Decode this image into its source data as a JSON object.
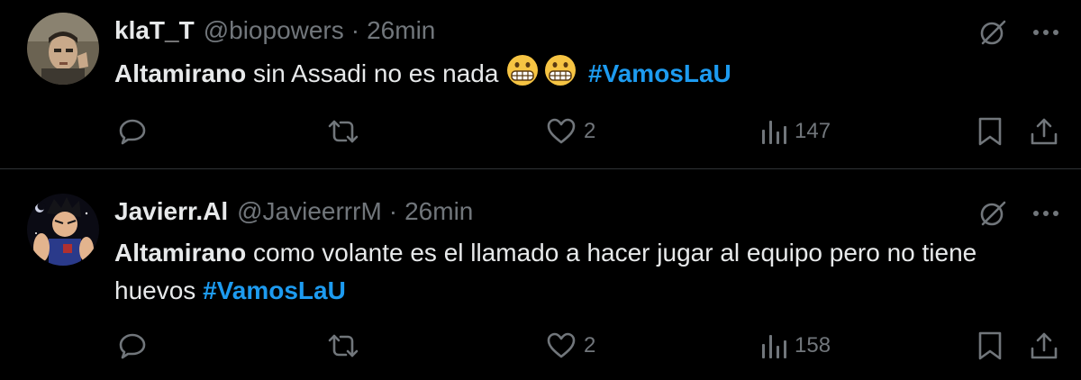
{
  "tweets": [
    {
      "name": "klaT_T",
      "handle": "@biopowers",
      "separator": "·",
      "time": "26min",
      "mention": "Altamirano",
      "text": " sin Assadi no es nada ",
      "emojis": [
        "grimacing-face",
        "grimacing-face"
      ],
      "hashtag": "#VamosLaU",
      "likes": "2",
      "views": "147"
    },
    {
      "name": "Javierr.Al",
      "handle": "@JavieerrrM",
      "separator": "·",
      "time": "26min",
      "mention": "Altamirano",
      "text": " como volante es el llamado a hacer jugar al equipo pero no tiene huevos  ",
      "emojis": [],
      "hashtag": "#VamosLaU",
      "likes": "2",
      "views": "158"
    }
  ],
  "icons": {
    "grok": "grok-icon",
    "more": "more-icon",
    "reply": "reply-icon",
    "retweet": "retweet-icon",
    "like": "heart-icon",
    "views": "views-icon",
    "bookmark": "bookmark-icon",
    "share": "share-icon"
  },
  "colors": {
    "background": "#000000",
    "text": "#e7e9ea",
    "secondary": "#71767b",
    "hashtag": "#1d9bf0",
    "divider": "#2f3336"
  }
}
